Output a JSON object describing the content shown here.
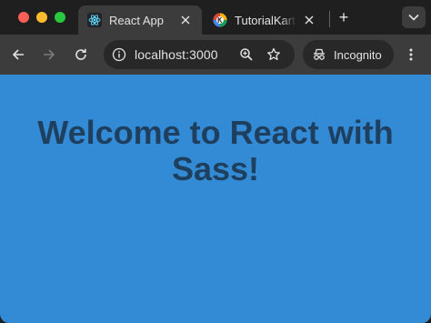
{
  "browser": {
    "tabs": [
      {
        "title": "React App",
        "favicon": "react-icon",
        "active": true
      },
      {
        "title": "TutorialKart -",
        "favicon": "tutorialkart-icon",
        "active": false
      }
    ],
    "new_tab_label": "+",
    "address": "localhost:3000",
    "incognito_label": "Incognito"
  },
  "page": {
    "heading": "Welcome to React with Sass!",
    "background_color": "#338bd6",
    "heading_color": "#1f3f5f"
  }
}
